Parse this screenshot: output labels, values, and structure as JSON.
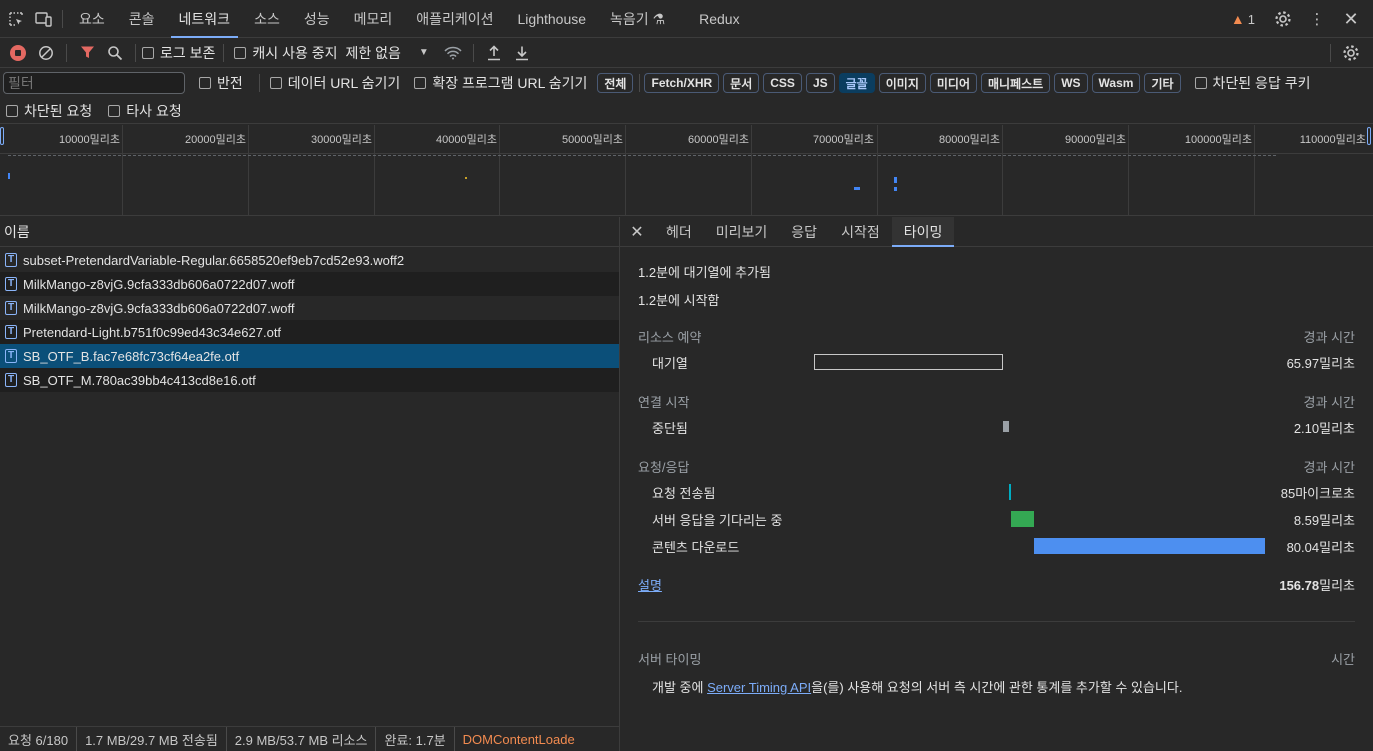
{
  "tabs": [
    "요소",
    "콘솔",
    "네트워크",
    "소스",
    "성능",
    "메모리",
    "애플리케이션",
    "Lighthouse",
    "녹음기 ⚗",
    "Redux"
  ],
  "warnings": {
    "count": "1"
  },
  "toolbar": {
    "preserve_log": "로그 보존",
    "disable_cache": "캐시 사용 중지",
    "throttle": "제한 없음"
  },
  "filter": {
    "placeholder": "필터",
    "invert": "반전",
    "hide_data_urls": "데이터 URL 숨기기",
    "hide_ext_urls": "확장 프로그램 URL 숨기기",
    "chips": [
      "전체",
      "Fetch/XHR",
      "문서",
      "CSS",
      "JS",
      "글꼴",
      "이미지",
      "미디어",
      "매니페스트",
      "WS",
      "Wasm",
      "기타"
    ],
    "active_chip": "글꼴",
    "blocked_cookies": "차단된 응답 쿠키",
    "blocked_requests": "차단된 요청",
    "third_party": "타사 요청"
  },
  "overview": {
    "ticks": [
      "10000밀리초",
      "20000밀리초",
      "30000밀리초",
      "40000밀리초",
      "50000밀리초",
      "60000밀리초",
      "70000밀리초",
      "80000밀리초",
      "90000밀리초",
      "100000밀리초",
      "110000밀리초"
    ]
  },
  "list": {
    "header": "이름",
    "selected_index": 4,
    "requests": [
      "subset-PretendardVariable-Regular.6658520ef9eb7cd52e93.woff2",
      "MilkMango-z8vjG.9cfa333db606a0722d07.woff",
      "MilkMango-z8vjG.9cfa333db606a0722d07.woff",
      "Pretendard-Light.b751f0c99ed43c34e627.otf",
      "SB_OTF_B.fac7e68fc73cf64ea2fe.otf",
      "SB_OTF_M.780ac39bb4c413cd8e16.otf"
    ]
  },
  "status": {
    "requests": "요청 6/180",
    "transferred": "1.7 MB/29.7 MB 전송됨",
    "resources": "2.9 MB/53.7 MB 리소스",
    "finish": "완료: 1.7분",
    "dcl": "DOMContentLoade"
  },
  "detail": {
    "tabs": [
      "헤더",
      "미리보기",
      "응답",
      "시작점",
      "타이밍"
    ],
    "active_tab": "타이밍",
    "queued_at": "1.2분에 대기열에 추가됨",
    "started_at": "1.2분에 시작함",
    "resource_scheduling": "리소스 예약",
    "connection_start": "연결 시작",
    "request_response": "요청/응답",
    "duration_header": "경과 시간",
    "rows": {
      "queueing": {
        "label": "대기열",
        "value": "65.97밀리초"
      },
      "stalled": {
        "label": "중단됨",
        "value": "2.10밀리초"
      },
      "request_sent": {
        "label": "요청 전송됨",
        "value": "85마이크로초"
      },
      "waiting": {
        "label": "서버 응답을 기다리는 중",
        "value": "8.59밀리초"
      },
      "download": {
        "label": "콘텐츠 다운로드",
        "value": "80.04밀리초"
      }
    },
    "explanation": "설명",
    "total_bold": "156.78",
    "total_unit": "밀리초",
    "server_timing": "서버 타이밍",
    "time_header": "시간",
    "server_note_pre": "개발 중에 ",
    "server_note_link": "Server Timing API",
    "server_note_post": "을(를) 사용해 요청의 서버 측 시간에 관한 통계를 추가할 수 있습니다.",
    "colors": {
      "waiting": "#34a853",
      "download": "#4285f4",
      "sent": "#00897b"
    }
  }
}
